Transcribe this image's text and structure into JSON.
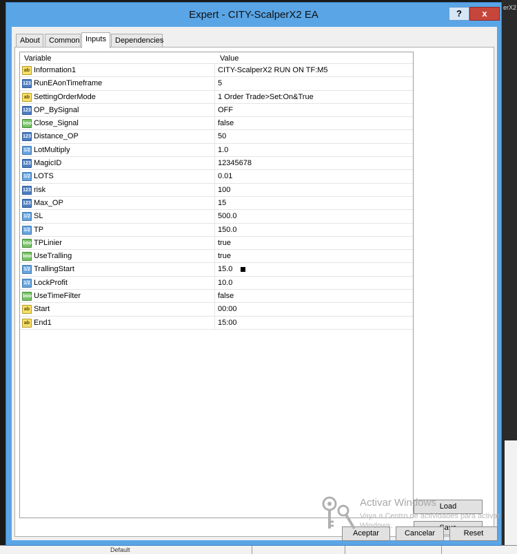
{
  "background": {
    "right_text": "erX2",
    "bottom_text": "Default"
  },
  "window": {
    "title": "Expert - CITY-ScalperX2 EA",
    "help_label": "?",
    "close_label": "x"
  },
  "tabs": [
    {
      "label": "About"
    },
    {
      "label": "Common"
    },
    {
      "label": "Inputs"
    },
    {
      "label": "Dependencies"
    }
  ],
  "inputs": {
    "header": {
      "variable": "Variable",
      "value": "Value"
    },
    "rows": [
      {
        "name": "Information1",
        "value": "CITY-ScalperX2 RUN ON TF:M5",
        "type": "ab"
      },
      {
        "name": "RunEAonTimeframe",
        "value": "5",
        "type": "123"
      },
      {
        "name": "SettingOrderMode",
        "value": "1 Order Trade>Set:On&True",
        "type": "ab"
      },
      {
        "name": "OP_BySignal",
        "value": "OFF",
        "type": "123"
      },
      {
        "name": "Close_Signal",
        "value": "false",
        "type": "bool"
      },
      {
        "name": "Distance_OP",
        "value": "50",
        "type": "123"
      },
      {
        "name": "LotMultiply",
        "value": "1.0",
        "type": "1/2"
      },
      {
        "name": "MagicID",
        "value": "12345678",
        "type": "123"
      },
      {
        "name": "LOTS",
        "value": "0.01",
        "type": "1/2"
      },
      {
        "name": "risk",
        "value": "100",
        "type": "123"
      },
      {
        "name": "Max_OP",
        "value": "15",
        "type": "123"
      },
      {
        "name": "SL",
        "value": "500.0",
        "type": "1/2"
      },
      {
        "name": "TP",
        "value": "150.0",
        "type": "1/2"
      },
      {
        "name": "TPLinier",
        "value": "true",
        "type": "bool"
      },
      {
        "name": "UseTralling",
        "value": "true",
        "type": "bool"
      },
      {
        "name": "TrallingStart",
        "value": "15.0",
        "type": "1/2"
      },
      {
        "name": "LockProfit",
        "value": "10.0",
        "type": "1/2"
      },
      {
        "name": "UseTimeFilter",
        "value": "false",
        "type": "bool"
      },
      {
        "name": "Start",
        "value": "00:00",
        "type": "ab"
      },
      {
        "name": "End1",
        "value": "15:00",
        "type": "ab"
      }
    ]
  },
  "buttons": {
    "load": "Load",
    "save": "Save",
    "ok": "Aceptar",
    "cancel": "Cancelar",
    "reset": "Reset"
  },
  "watermark": {
    "title": "Activar Windows",
    "line1": "Vaya a Centro de actividades para activar",
    "line2": "Windows."
  }
}
